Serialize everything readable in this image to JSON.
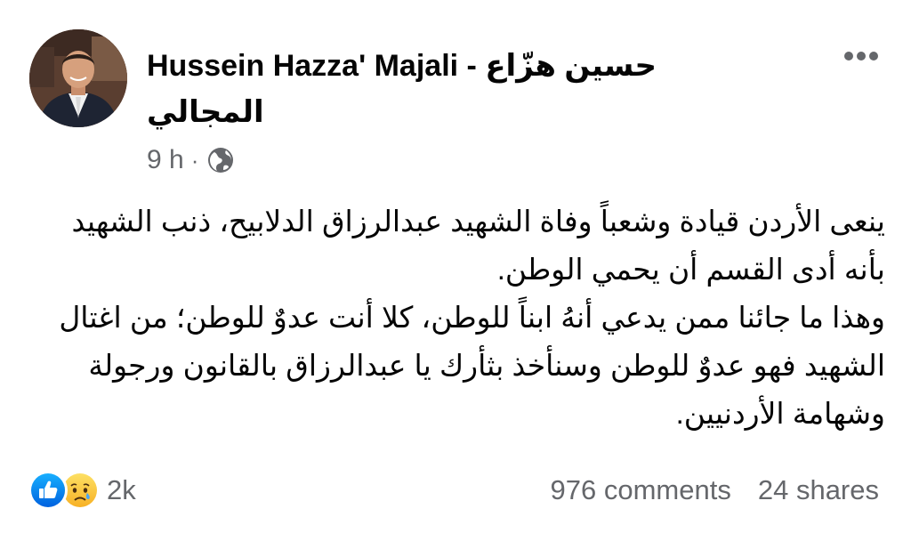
{
  "post": {
    "author_latin": "Hussein Hazza' Majali -",
    "author_arabic_1": "حسين هزّاع",
    "author_arabic_2": "المجالي",
    "time": "9 h",
    "separator": "·",
    "privacy_icon": "globe-icon",
    "more_icon": "more-options-icon",
    "paragraphs": [
      "ينعى الأردن قيادة وشعباً وفاة الشهيد عبدالرزاق الدلابيح، ذنب الشهيد بأنه أدى القسم أن يحمي الوطن.",
      "وهذا ما جائنا ممن يدعي أنهُ ابناً للوطن، كلا أنت عدوٌ للوطن؛ من اغتال الشهيد فهو عدوٌ للوطن وسنأخذ بثأرك يا عبدالرزاق بالقانون ورجولة وشهامة الأردنيين."
    ]
  },
  "footer": {
    "reactions": [
      "like",
      "sad"
    ],
    "reaction_count": "2k",
    "comments": "976 comments",
    "shares": "24 shares"
  },
  "colors": {
    "text": "#050505",
    "secondary": "#65676b",
    "like_blue": "#1877f2",
    "sad_yellow": "#f7b125"
  }
}
